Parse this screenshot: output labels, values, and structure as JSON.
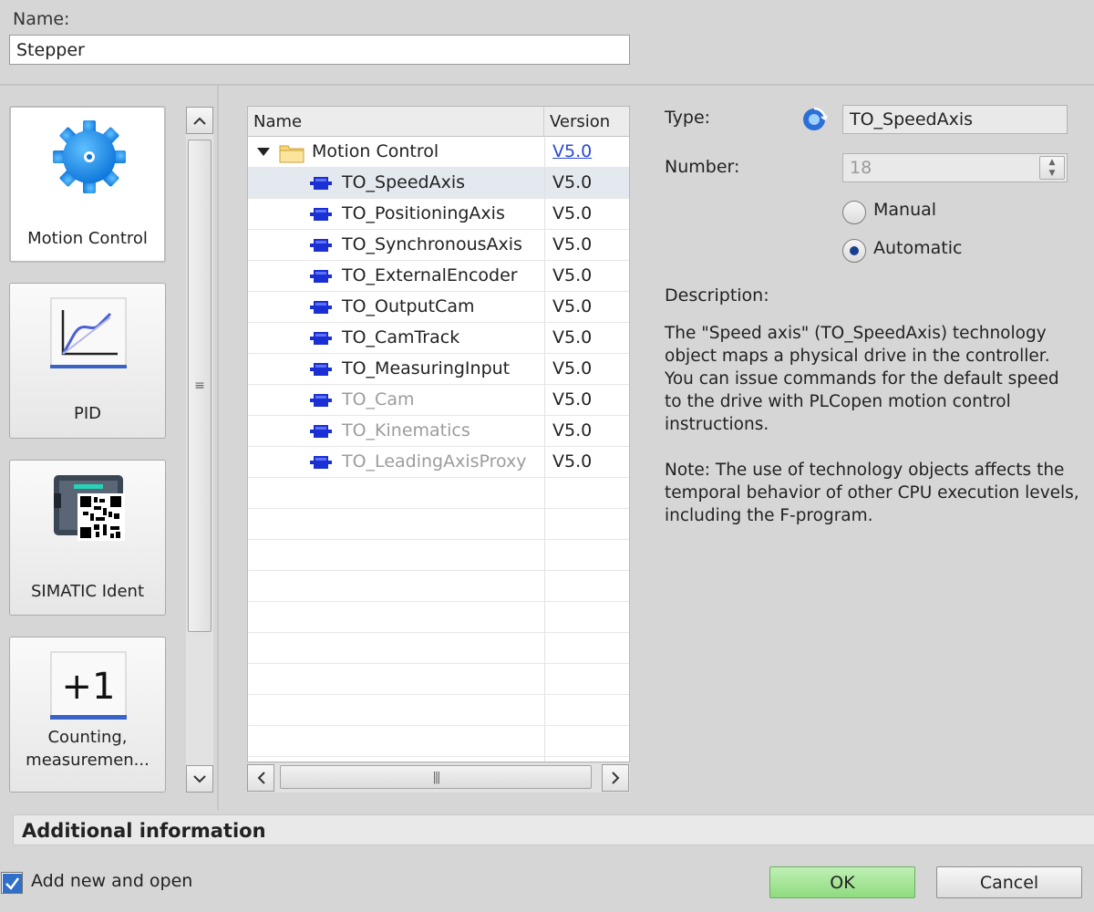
{
  "name_section": {
    "label": "Name:",
    "value": "Stepper"
  },
  "categories": [
    {
      "label": "Motion Control",
      "icon": "gear-icon",
      "selected": true
    },
    {
      "label": "PID",
      "icon": "pid-chart-icon",
      "selected": false
    },
    {
      "label": "SIMATIC Ident",
      "icon": "rfid-reader-icon",
      "selected": false
    },
    {
      "label": "Counting, measuremen...",
      "label_line1": "Counting,",
      "label_line2": "measuremen...",
      "icon": "counter-plus-one-icon",
      "icon_text": "+1",
      "selected": false
    }
  ],
  "tree": {
    "columns": {
      "name": "Name",
      "version": "Version"
    },
    "folder": {
      "label": "Motion Control",
      "version": "V5.0"
    },
    "items": [
      {
        "name": "TO_SpeedAxis",
        "version": "V5.0",
        "enabled": true,
        "selected": true
      },
      {
        "name": "TO_PositioningAxis",
        "version": "V5.0",
        "enabled": true
      },
      {
        "name": "TO_SynchronousAxis",
        "version": "V5.0",
        "enabled": true
      },
      {
        "name": "TO_ExternalEncoder",
        "version": "V5.0",
        "enabled": true
      },
      {
        "name": "TO_OutputCam",
        "version": "V5.0",
        "enabled": true
      },
      {
        "name": "TO_CamTrack",
        "version": "V5.0",
        "enabled": true
      },
      {
        "name": "TO_MeasuringInput",
        "version": "V5.0",
        "enabled": true
      },
      {
        "name": "TO_Cam",
        "version": "V5.0",
        "enabled": false
      },
      {
        "name": "TO_Kinematics",
        "version": "V5.0",
        "enabled": false
      },
      {
        "name": "TO_LeadingAxisProxy",
        "version": "V5.0",
        "enabled": false
      }
    ]
  },
  "details": {
    "type_label": "Type:",
    "type_value": "TO_SpeedAxis",
    "number_label": "Number:",
    "number_value": "18",
    "radio_manual": "Manual",
    "radio_automatic": "Automatic",
    "selected_radio": "Automatic",
    "description_label": "Description:",
    "description_p1": "The \"Speed axis\" (TO_SpeedAxis) technology object maps a physical drive in the controller.",
    "description_p2": "You can issue commands for the default speed to the drive with PLCopen motion control instructions.",
    "description_p3": "Note: The use of technology objects affects the temporal behavior of other CPU execution levels, including the F-program."
  },
  "additional_info": {
    "label": "Additional information"
  },
  "footer": {
    "checkbox_label": "Add new and open",
    "checkbox_checked": true,
    "ok_label": "OK",
    "cancel_label": "Cancel"
  },
  "colors": {
    "ok_button": "#9ee28f",
    "link": "#2a49d6",
    "item_icon": "#1a2fd4",
    "selection": "#e4e9ef"
  }
}
